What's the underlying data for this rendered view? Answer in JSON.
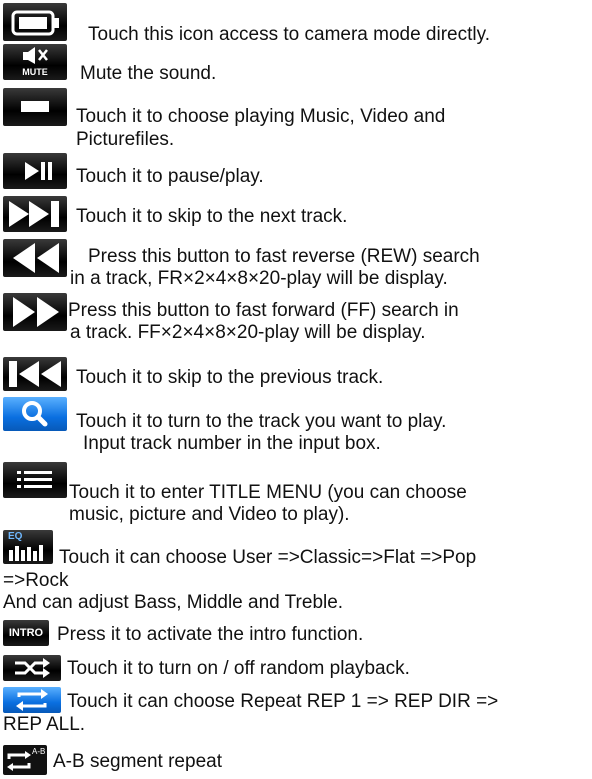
{
  "entries": [
    {
      "icon": "camera-mode-icon",
      "lines": [
        "Touch this icon access to camera mode directly."
      ]
    },
    {
      "icon": "mute-icon",
      "label": "MUTE",
      "lines": [
        "Mute the sound."
      ]
    },
    {
      "icon": "source-select-icon",
      "lines": [
        "Touch it to choose playing Music, Video and",
        "Picturefiles."
      ]
    },
    {
      "icon": "play-pause-icon",
      "lines": [
        "Touch it to pause/play."
      ]
    },
    {
      "icon": "next-track-icon",
      "lines": [
        "Touch it to skip to the next track."
      ]
    },
    {
      "icon": "fast-reverse-icon",
      "lines": [
        "Press this button to fast reverse (REW) search",
        "in a track, FR×2×4×8×20-play will be display."
      ]
    },
    {
      "icon": "fast-forward-icon",
      "lines": [
        "Press this button to fast forward (FF) search in",
        "a track. FF×2×4×8×20-play will be display."
      ]
    },
    {
      "icon": "previous-track-icon",
      "lines": [
        "Touch it to skip to the previous track."
      ]
    },
    {
      "icon": "search-icon",
      "lines": [
        "Touch it to turn to the track you want to play.",
        "Input track number in the input box."
      ]
    },
    {
      "icon": "title-menu-icon",
      "lines": [
        "Touch it to enter TITLE MENU (you can choose",
        "music, picture and Video to play)."
      ]
    },
    {
      "icon": "eq-icon",
      "label": "EQ",
      "lines": [
        "Touch it can choose User =>Classic=>Flat =>Pop",
        "=>Rock",
        "And can adjust Bass, Middle and Treble."
      ]
    },
    {
      "icon": "intro-icon",
      "label": "INTRO",
      "lines": [
        "Press it to activate the intro function."
      ]
    },
    {
      "icon": "random-icon",
      "lines": [
        "Touch it to turn on / off random playback."
      ]
    },
    {
      "icon": "repeat-icon",
      "lines": [
        "Touch it can choose Repeat REP 1 => REP DIR =>",
        "REP ALL."
      ]
    },
    {
      "icon": "ab-repeat-icon",
      "label": "A-B",
      "lines": [
        "A-B segment repeat"
      ]
    }
  ]
}
